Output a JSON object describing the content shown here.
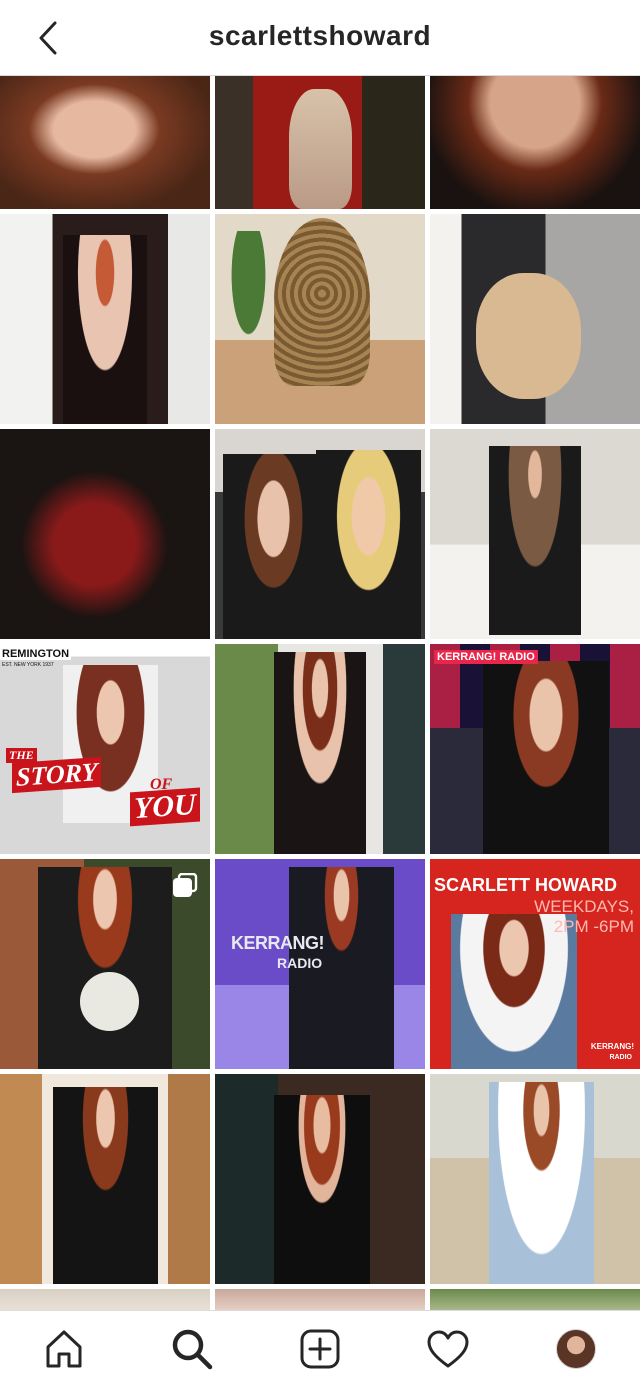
{
  "header": {
    "title": "scarlettshoward",
    "back_icon": "chevron-left-icon"
  },
  "posts": [
    {
      "id": "post-1"
    },
    {
      "id": "post-2"
    },
    {
      "id": "post-3"
    },
    {
      "id": "post-4"
    },
    {
      "id": "post-5"
    },
    {
      "id": "post-6"
    },
    {
      "id": "post-7"
    },
    {
      "id": "post-8"
    },
    {
      "id": "post-9"
    },
    {
      "id": "post-10",
      "brand": "REMINGTON",
      "brand_sub": "EST. NEW YORK 1937",
      "caption_1": "THE",
      "caption_2": "STORY",
      "caption_3": "OF",
      "caption_4": "YOU"
    },
    {
      "id": "post-11"
    },
    {
      "id": "post-12",
      "sign": "KERRANG! RADIO"
    },
    {
      "id": "post-13",
      "multi_icon": "carousel-icon"
    },
    {
      "id": "post-14",
      "sign_1": "KERRANG!",
      "sign_2": "RADIO"
    },
    {
      "id": "post-15",
      "headline": "SCARLETT HOWARD",
      "sub_1": "WEEKDAYS,",
      "sub_2": "2PM -6PM",
      "logo_1": "KERRANG!",
      "logo_2": "RADIO"
    },
    {
      "id": "post-16"
    },
    {
      "id": "post-17"
    },
    {
      "id": "post-18"
    },
    {
      "id": "post-19"
    },
    {
      "id": "post-20"
    },
    {
      "id": "post-21"
    }
  ],
  "tabbar": {
    "home_icon": "home-icon",
    "search_icon": "search-icon",
    "add_icon": "add-post-icon",
    "activity_icon": "heart-icon",
    "profile_icon": "profile-avatar"
  },
  "colors": {
    "text": "#262626",
    "divider": "#dbdbdb",
    "kerrang_red": "#d6241e"
  }
}
